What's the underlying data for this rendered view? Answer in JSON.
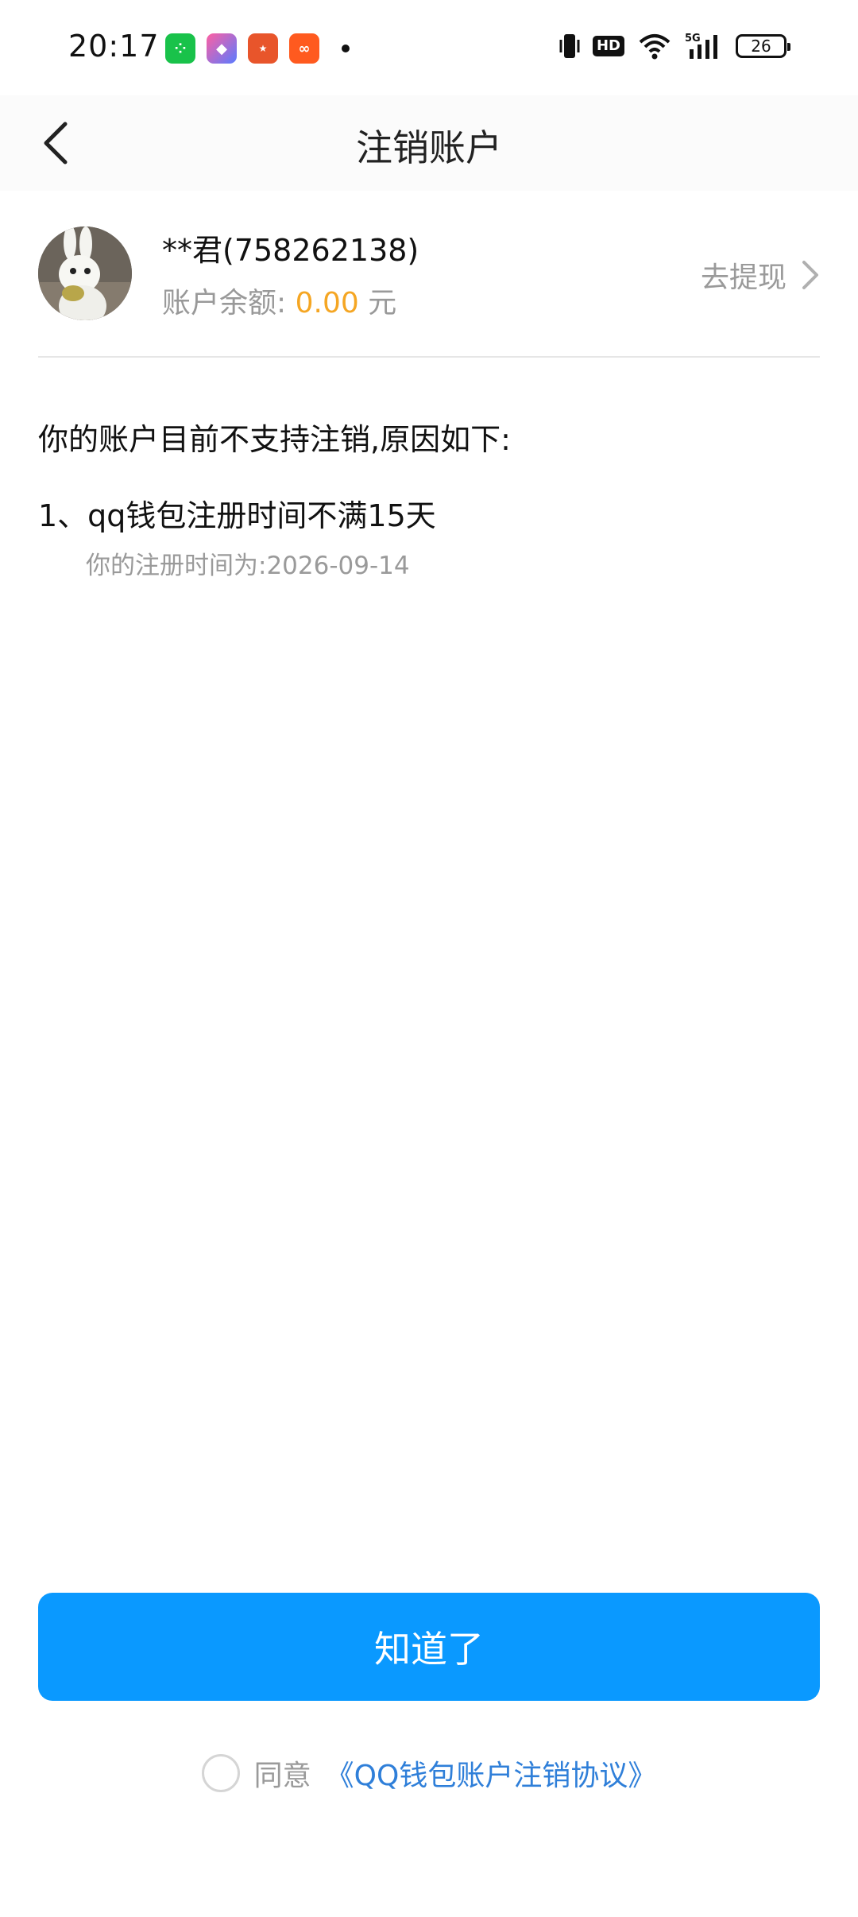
{
  "status_bar": {
    "time": "20:17",
    "network": "5G",
    "battery": "26",
    "hd_label": "HD"
  },
  "nav": {
    "title": "注销账户"
  },
  "account": {
    "name": "**君(758262138)",
    "balance_label": "账户余额:",
    "balance_value": "0.00",
    "balance_unit": "元",
    "withdraw_label": "去提现"
  },
  "content": {
    "reason_title": "你的账户目前不支持注销,原因如下:",
    "reasons": [
      {
        "text": "1、qq钱包注册时间不满15天",
        "detail": "你的注册时间为:2026-09-14"
      }
    ]
  },
  "footer": {
    "button_label": "知道了",
    "agree_label": "同意",
    "agreement_link": "《QQ钱包账户注销协议》"
  },
  "colors": {
    "primary": "#0a99ff",
    "balance": "#f5a623",
    "link": "#2f7fd9"
  }
}
